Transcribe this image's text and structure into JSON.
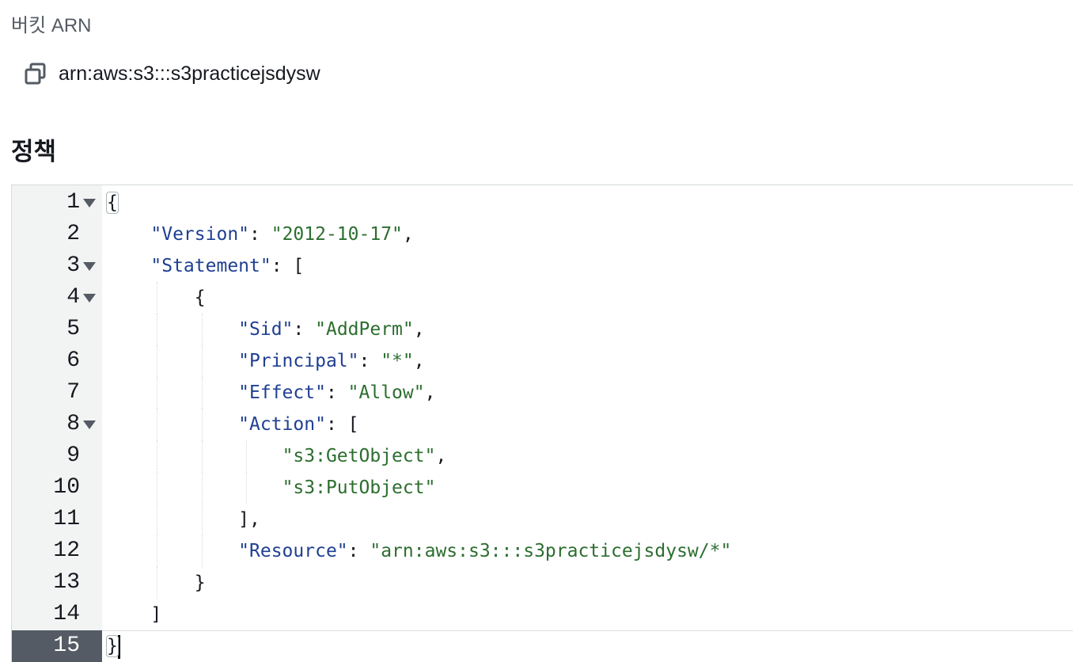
{
  "arn_section": {
    "label": "버킷 ARN",
    "value": "arn:aws:s3:::s3practicejsdysw",
    "copy_icon": "copy-icon"
  },
  "policy_section": {
    "heading": "정책"
  },
  "editor": {
    "active_line": 15,
    "lines": [
      {
        "num": "1",
        "fold": true,
        "indent": 0,
        "tokens": [
          {
            "t": "{",
            "c": "punc"
          }
        ]
      },
      {
        "num": "2",
        "fold": false,
        "indent": 1,
        "tokens": [
          {
            "t": "\"Version\"",
            "c": "key"
          },
          {
            "t": ": ",
            "c": "punc"
          },
          {
            "t": "\"2012-10-17\"",
            "c": "str"
          },
          {
            "t": ",",
            "c": "punc"
          }
        ]
      },
      {
        "num": "3",
        "fold": true,
        "indent": 1,
        "tokens": [
          {
            "t": "\"Statement\"",
            "c": "key"
          },
          {
            "t": ": [",
            "c": "punc"
          }
        ]
      },
      {
        "num": "4",
        "fold": true,
        "indent": 2,
        "tokens": [
          {
            "t": "{",
            "c": "punc"
          }
        ]
      },
      {
        "num": "5",
        "fold": false,
        "indent": 3,
        "tokens": [
          {
            "t": "\"Sid\"",
            "c": "key"
          },
          {
            "t": ": ",
            "c": "punc"
          },
          {
            "t": "\"AddPerm\"",
            "c": "str"
          },
          {
            "t": ",",
            "c": "punc"
          }
        ]
      },
      {
        "num": "6",
        "fold": false,
        "indent": 3,
        "tokens": [
          {
            "t": "\"Principal\"",
            "c": "key"
          },
          {
            "t": ": ",
            "c": "punc"
          },
          {
            "t": "\"*\"",
            "c": "str"
          },
          {
            "t": ",",
            "c": "punc"
          }
        ]
      },
      {
        "num": "7",
        "fold": false,
        "indent": 3,
        "tokens": [
          {
            "t": "\"Effect\"",
            "c": "key"
          },
          {
            "t": ": ",
            "c": "punc"
          },
          {
            "t": "\"Allow\"",
            "c": "str"
          },
          {
            "t": ",",
            "c": "punc"
          }
        ]
      },
      {
        "num": "8",
        "fold": true,
        "indent": 3,
        "tokens": [
          {
            "t": "\"Action\"",
            "c": "key"
          },
          {
            "t": ": [",
            "c": "punc"
          }
        ]
      },
      {
        "num": "9",
        "fold": false,
        "indent": 4,
        "tokens": [
          {
            "t": "\"s3:GetObject\"",
            "c": "str"
          },
          {
            "t": ",",
            "c": "punc"
          }
        ]
      },
      {
        "num": "10",
        "fold": false,
        "indent": 4,
        "tokens": [
          {
            "t": "\"s3:PutObject\"",
            "c": "str"
          }
        ]
      },
      {
        "num": "11",
        "fold": false,
        "indent": 3,
        "tokens": [
          {
            "t": "],",
            "c": "punc"
          }
        ]
      },
      {
        "num": "12",
        "fold": false,
        "indent": 3,
        "tokens": [
          {
            "t": "\"Resource\"",
            "c": "key"
          },
          {
            "t": ": ",
            "c": "punc"
          },
          {
            "t": "\"arn:aws:s3:::s3practicejsdysw/*\"",
            "c": "str"
          }
        ]
      },
      {
        "num": "13",
        "fold": false,
        "indent": 2,
        "tokens": [
          {
            "t": "}",
            "c": "punc"
          }
        ]
      },
      {
        "num": "14",
        "fold": false,
        "indent": 1,
        "tokens": [
          {
            "t": "]",
            "c": "punc"
          }
        ]
      },
      {
        "num": "15",
        "fold": false,
        "indent": 0,
        "tokens": [
          {
            "t": "}",
            "c": "punc"
          }
        ]
      }
    ]
  },
  "colors": {
    "key": "#1f3f91",
    "string": "#2c6e2f",
    "gutter_bg": "#f2f3f3",
    "active_gutter": "#545b64"
  }
}
